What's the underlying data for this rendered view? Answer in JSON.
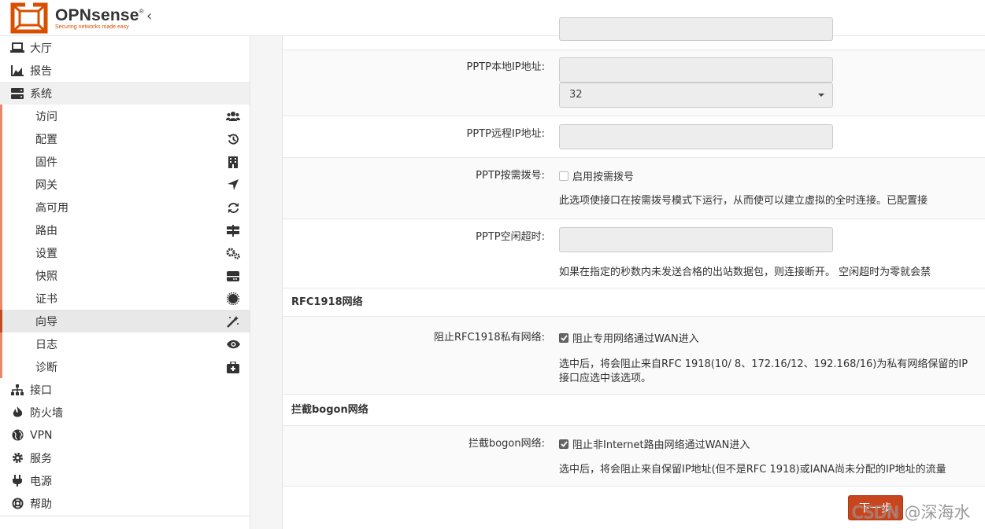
{
  "brand": {
    "name": "OPNsense",
    "tagline": "Securing networks made easy",
    "accent": "#d94f00"
  },
  "sidebar": {
    "top_items": [
      {
        "label": "大厅",
        "icon": "laptop-icon"
      },
      {
        "label": "报告",
        "icon": "chart-area-icon"
      },
      {
        "label": "系统",
        "icon": "server-icon"
      }
    ],
    "sub_items": [
      {
        "label": "访问",
        "icon": "users-icon"
      },
      {
        "label": "配置",
        "icon": "history-icon"
      },
      {
        "label": "固件",
        "icon": "building-icon"
      },
      {
        "label": "网关",
        "icon": "location-arrow-icon"
      },
      {
        "label": "高可用",
        "icon": "refresh-icon"
      },
      {
        "label": "路由",
        "icon": "signs-icon"
      },
      {
        "label": "设置",
        "icon": "cogs-icon"
      },
      {
        "label": "快照",
        "icon": "hdd-icon"
      },
      {
        "label": "证书",
        "icon": "certificate-icon"
      },
      {
        "label": "向导",
        "icon": "magic-wand-icon"
      },
      {
        "label": "日志",
        "icon": "eye-icon"
      },
      {
        "label": "诊断",
        "icon": "medkit-icon"
      }
    ],
    "bottom_items": [
      {
        "label": "接口",
        "icon": "sitemap-icon"
      },
      {
        "label": "防火墙",
        "icon": "fire-icon"
      },
      {
        "label": "VPN",
        "icon": "globe-icon"
      },
      {
        "label": "服务",
        "icon": "cog-icon"
      },
      {
        "label": "电源",
        "icon": "plug-icon"
      },
      {
        "label": "帮助",
        "icon": "life-ring-icon"
      }
    ],
    "current": "向导"
  },
  "form": {
    "pptp_local_label": "PPTP本地IP地址:",
    "pptp_local_value": "",
    "pptp_subnet_value": "32",
    "pptp_remote_label": "PPTP远程IP地址:",
    "pptp_remote_value": "",
    "pptp_ondemand_label": "PPTP按需拨号:",
    "pptp_ondemand_checkbox": "启用按需拨号",
    "pptp_ondemand_checked": false,
    "pptp_ondemand_help": "此选项使接口在按需拨号模式下运行，从而使可以建立虚拟的全时连接。已配置接",
    "pptp_idle_label": "PPTP空闲超时:",
    "pptp_idle_value": "",
    "pptp_idle_help": "如果在指定的秒数内未发送合格的出站数据包，则连接断开。 空闲超时为零就会禁",
    "rfc1918_section": "RFC1918网络",
    "rfc1918_label": "阻止RFC1918私有网络:",
    "rfc1918_checkbox": "阻止专用网络通过WAN进入",
    "rfc1918_checked": true,
    "rfc1918_help_1": "选中后，将会阻止来自RFC 1918(10/ 8、172.16/12、192.168/16)为私有网络保留的IP",
    "rfc1918_help_2": "接口应选中该选项。",
    "bogon_section": "拦截bogon网络",
    "bogon_label": "拦截bogon网络:",
    "bogon_checkbox": "阻止非Internet路由网络通过WAN进入",
    "bogon_checked": true,
    "bogon_help": "选中后，将会阻止来自保留IP地址(但不是RFC 1918)或IANA尚未分配的IP地址的流量",
    "next_button": "下一步"
  },
  "watermark": "CSDN @深海水"
}
